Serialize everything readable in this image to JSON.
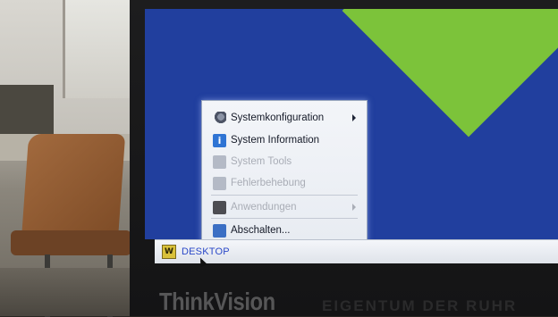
{
  "menu": {
    "items": [
      {
        "label": "Systemkonfiguration",
        "icon": "gear-icon",
        "enabled": true,
        "submenu": true
      },
      {
        "label": "System Information",
        "icon": "info-icon",
        "enabled": true,
        "submenu": false
      },
      {
        "label": "System Tools",
        "icon": "tools-icon",
        "enabled": false,
        "submenu": false
      },
      {
        "label": "Fehlerbehebung",
        "icon": "troubleshoot-icon",
        "enabled": false,
        "submenu": false
      },
      {
        "label": "Anwendungen",
        "icon": "apps-icon",
        "enabled": false,
        "submenu": true
      },
      {
        "label": "Abschalten...",
        "icon": "power-icon",
        "enabled": true,
        "submenu": false
      }
    ]
  },
  "taskbar": {
    "start_icon_letter": "W",
    "start_label": "DESKTOP"
  },
  "monitor": {
    "brand": "ThinkVision",
    "sticker": "EIGENTUM DER RUHR"
  },
  "colors": {
    "desktop_background": "#213f9e",
    "desktop_shape": "#7cc33a",
    "taskbar_label": "#2b49c8"
  }
}
